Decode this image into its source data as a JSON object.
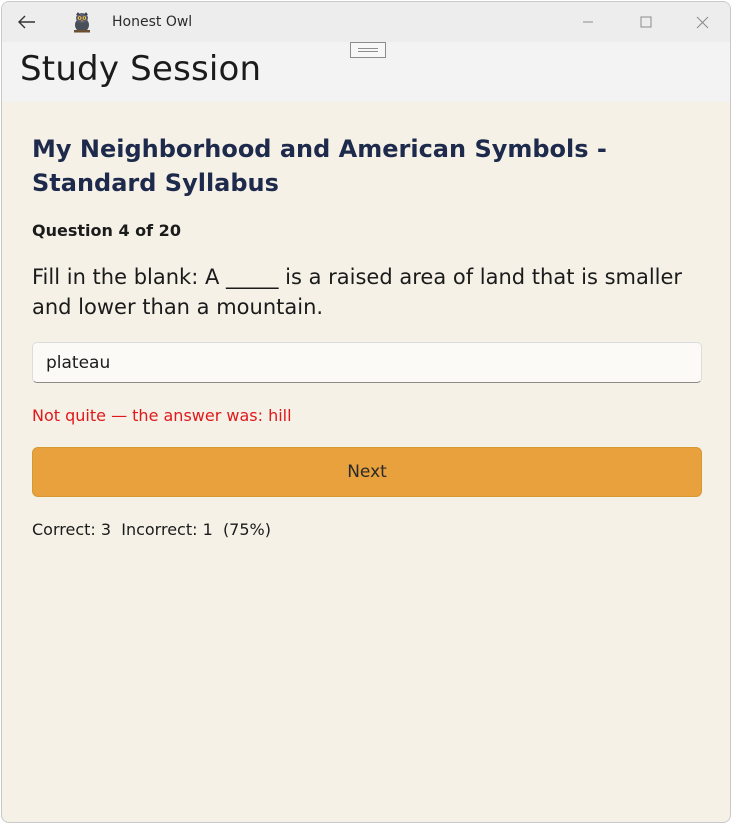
{
  "window": {
    "app_title": "Honest Owl",
    "icons": {
      "back": "arrow-left-icon",
      "app": "owl-icon",
      "minimize": "minimize-icon",
      "maximize": "maximize-icon",
      "close": "close-icon"
    }
  },
  "header": {
    "title": "Study Session"
  },
  "session": {
    "deck_title": "My Neighborhood and American Symbols - Standard Syllabus",
    "question_counter": "Question 4 of 20",
    "question_text": "Fill in the blank: A _____ is a raised area of land that is smaller and lower than a mountain.",
    "answer_value": "plateau",
    "feedback": "Not quite — the answer was: hill",
    "next_label": "Next",
    "score_text": "Correct: 3  Incorrect: 1  (75%)"
  },
  "colors": {
    "background": "#f5f1e7",
    "accent_button": "#e8a13c",
    "error_text": "#e0181b",
    "title_text": "#1d2a4b"
  }
}
